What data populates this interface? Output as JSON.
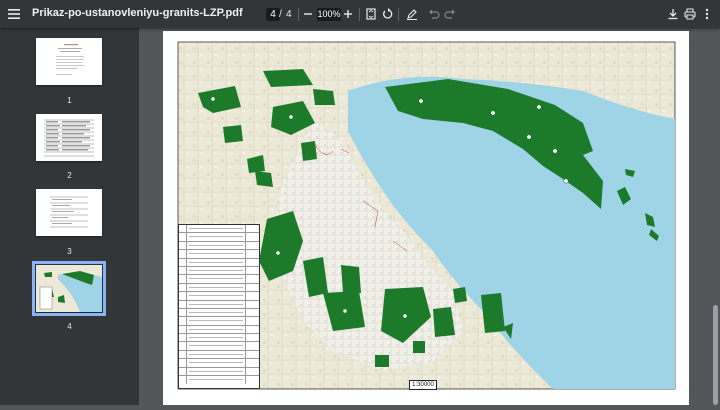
{
  "toolbar": {
    "title": "Prikaz-po-ustanovleniyu-granits-LZP.pdf",
    "current_page": "4",
    "page_separator": "/",
    "total_pages": "4",
    "zoom": "100%"
  },
  "sidebar": {
    "thumbnails": [
      {
        "label": "1"
      },
      {
        "label": "2"
      },
      {
        "label": "3"
      },
      {
        "label": "4"
      }
    ],
    "selected": "4"
  },
  "map": {
    "scale_label": "1:30000"
  },
  "colors": {
    "toolbar_bg": "#323639",
    "viewer_bg": "#525659",
    "accent": "#8ab4f8",
    "forest_green": "#1e7a2b",
    "sea_blue": "#9fd3e6",
    "land_beige": "#ece9d8"
  }
}
